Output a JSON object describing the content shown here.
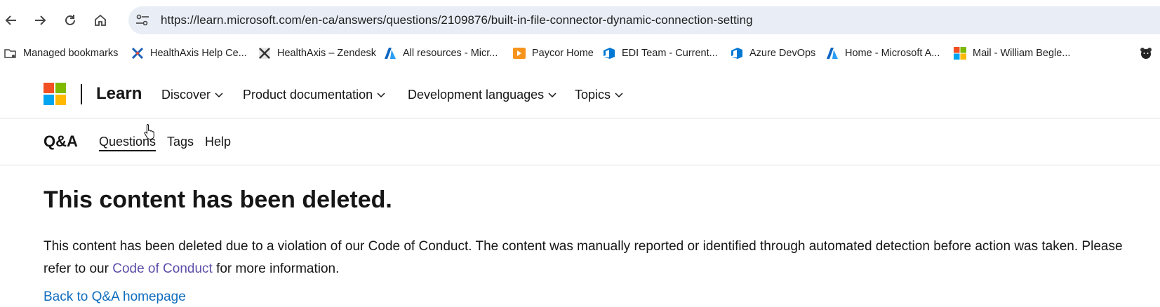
{
  "browser": {
    "url": "https://learn.microsoft.com/en-ca/answers/questions/2109876/built-in-file-connector-dynamic-connection-setting",
    "bookmarks": [
      {
        "label": "Managed bookmarks",
        "icon": "folder-managed-icon"
      },
      {
        "label": "HealthAxis Help Ce...",
        "icon": "healthaxis-icon"
      },
      {
        "label": "HealthAxis – Zendesk",
        "icon": "zendesk-icon"
      },
      {
        "label": "All resources - Micr...",
        "icon": "azure-icon"
      },
      {
        "label": "Paycor Home",
        "icon": "paycor-icon"
      },
      {
        "label": "EDI Team - Current...",
        "icon": "azure-devops-icon"
      },
      {
        "label": "Azure DevOps",
        "icon": "azure-devops-icon"
      },
      {
        "label": "Home - Microsoft A...",
        "icon": "azure-icon"
      },
      {
        "label": "Mail - William Begle...",
        "icon": "microsoft-icon"
      }
    ]
  },
  "site": {
    "brand": "Learn",
    "nav": [
      "Discover",
      "Product documentation",
      "Development languages",
      "Topics"
    ]
  },
  "qa": {
    "title": "Q&A",
    "nav": [
      "Questions",
      "Tags",
      "Help"
    ],
    "active": "Questions"
  },
  "content": {
    "title": "This content has been deleted.",
    "body_before": "This content has been deleted due to a violation of our Code of Conduct. The content was manually reported or identified through automated detection before action was taken. Please refer to our ",
    "link": "Code of Conduct",
    "body_after": " for more information.",
    "back": "Back to Q&A homepage"
  },
  "colors": {
    "accent_link": "#0f6cbd",
    "visited_link": "#5c4ea8",
    "ms_red": "#f25022",
    "ms_green": "#7fba00",
    "ms_blue": "#00a4ef",
    "ms_yellow": "#ffb900"
  }
}
